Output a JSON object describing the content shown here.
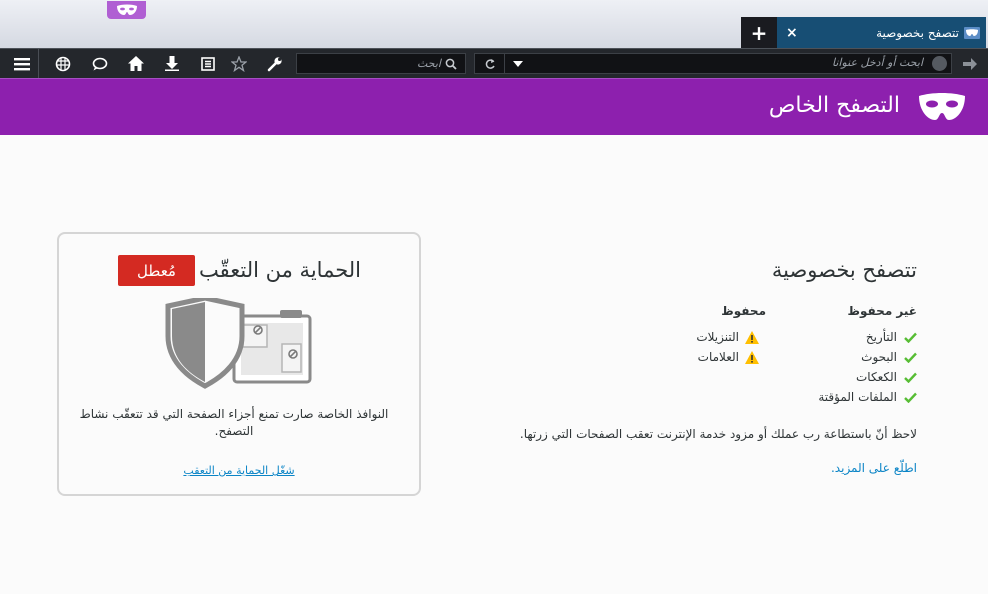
{
  "browser": {
    "tab_title": "تتصفح بخصوصية",
    "new_tab_label": "+",
    "close_label": "×",
    "search_placeholder": "ابحث",
    "url_placeholder": "ابحث أو أدخل عنوانا"
  },
  "header": {
    "title": "التصفح الخاص"
  },
  "privacy": {
    "title": "تتصفح بخصوصية",
    "not_saved_heading": "غير محفوظ",
    "saved_heading": "محفوظ",
    "not_saved_items": [
      "التأريخ",
      "البحوث",
      "الكعكات",
      "الملفات المؤقتة"
    ],
    "saved_items": [
      "التنزيلات",
      "العلامات"
    ],
    "note": "لاحظ أنّ باستطاعة رب عملك أو مزود خدمة الإنترنت تعقب الصفحات التي زرتها.",
    "learn_more": "اطلّع على المزيد."
  },
  "tracking": {
    "title": "الحماية من التعقّب",
    "status_badge": "مُعطل",
    "description": "النوافذ الخاصة صارت تمنع أجزاء الصفحة التي قد تتعقّب نشاط التصفح.",
    "enable_link": "شغّل الحماية من التعقب"
  },
  "colors": {
    "header_purple": "#8d20ae",
    "tab_blue": "#174e74",
    "toolbar_dark": "#24272c",
    "badge_red": "#d42a22",
    "check_green": "#57bd35",
    "warning_yellow": "#ffbf00",
    "link_blue": "#0a84c6"
  },
  "icons": {
    "toolbar": [
      "menu-icon",
      "addons-icon",
      "chat-icon",
      "home-icon",
      "download-icon",
      "reading-list-icon",
      "bookmark-star-icon",
      "developer-wrench-icon"
    ],
    "search": "search-icon",
    "reload": "reload-icon",
    "back": "back-arrow-icon"
  }
}
